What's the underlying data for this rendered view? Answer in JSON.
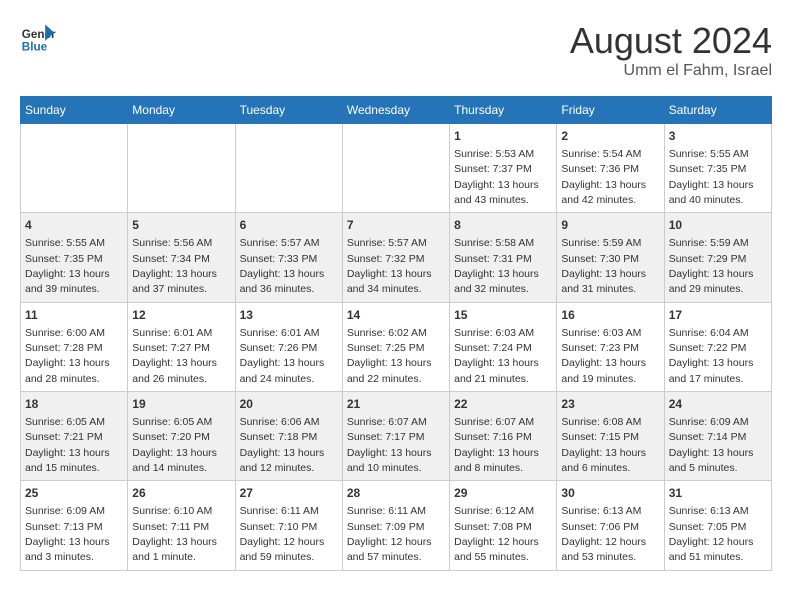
{
  "header": {
    "logo_line1": "General",
    "logo_line2": "Blue",
    "title": "August 2024",
    "subtitle": "Umm el Fahm, Israel"
  },
  "weekdays": [
    "Sunday",
    "Monday",
    "Tuesday",
    "Wednesday",
    "Thursday",
    "Friday",
    "Saturday"
  ],
  "weeks": [
    [
      {
        "day": "",
        "info": ""
      },
      {
        "day": "",
        "info": ""
      },
      {
        "day": "",
        "info": ""
      },
      {
        "day": "",
        "info": ""
      },
      {
        "day": "1",
        "info": "Sunrise: 5:53 AM\nSunset: 7:37 PM\nDaylight: 13 hours\nand 43 minutes."
      },
      {
        "day": "2",
        "info": "Sunrise: 5:54 AM\nSunset: 7:36 PM\nDaylight: 13 hours\nand 42 minutes."
      },
      {
        "day": "3",
        "info": "Sunrise: 5:55 AM\nSunset: 7:35 PM\nDaylight: 13 hours\nand 40 minutes."
      }
    ],
    [
      {
        "day": "4",
        "info": "Sunrise: 5:55 AM\nSunset: 7:35 PM\nDaylight: 13 hours\nand 39 minutes."
      },
      {
        "day": "5",
        "info": "Sunrise: 5:56 AM\nSunset: 7:34 PM\nDaylight: 13 hours\nand 37 minutes."
      },
      {
        "day": "6",
        "info": "Sunrise: 5:57 AM\nSunset: 7:33 PM\nDaylight: 13 hours\nand 36 minutes."
      },
      {
        "day": "7",
        "info": "Sunrise: 5:57 AM\nSunset: 7:32 PM\nDaylight: 13 hours\nand 34 minutes."
      },
      {
        "day": "8",
        "info": "Sunrise: 5:58 AM\nSunset: 7:31 PM\nDaylight: 13 hours\nand 32 minutes."
      },
      {
        "day": "9",
        "info": "Sunrise: 5:59 AM\nSunset: 7:30 PM\nDaylight: 13 hours\nand 31 minutes."
      },
      {
        "day": "10",
        "info": "Sunrise: 5:59 AM\nSunset: 7:29 PM\nDaylight: 13 hours\nand 29 minutes."
      }
    ],
    [
      {
        "day": "11",
        "info": "Sunrise: 6:00 AM\nSunset: 7:28 PM\nDaylight: 13 hours\nand 28 minutes."
      },
      {
        "day": "12",
        "info": "Sunrise: 6:01 AM\nSunset: 7:27 PM\nDaylight: 13 hours\nand 26 minutes."
      },
      {
        "day": "13",
        "info": "Sunrise: 6:01 AM\nSunset: 7:26 PM\nDaylight: 13 hours\nand 24 minutes."
      },
      {
        "day": "14",
        "info": "Sunrise: 6:02 AM\nSunset: 7:25 PM\nDaylight: 13 hours\nand 22 minutes."
      },
      {
        "day": "15",
        "info": "Sunrise: 6:03 AM\nSunset: 7:24 PM\nDaylight: 13 hours\nand 21 minutes."
      },
      {
        "day": "16",
        "info": "Sunrise: 6:03 AM\nSunset: 7:23 PM\nDaylight: 13 hours\nand 19 minutes."
      },
      {
        "day": "17",
        "info": "Sunrise: 6:04 AM\nSunset: 7:22 PM\nDaylight: 13 hours\nand 17 minutes."
      }
    ],
    [
      {
        "day": "18",
        "info": "Sunrise: 6:05 AM\nSunset: 7:21 PM\nDaylight: 13 hours\nand 15 minutes."
      },
      {
        "day": "19",
        "info": "Sunrise: 6:05 AM\nSunset: 7:20 PM\nDaylight: 13 hours\nand 14 minutes."
      },
      {
        "day": "20",
        "info": "Sunrise: 6:06 AM\nSunset: 7:18 PM\nDaylight: 13 hours\nand 12 minutes."
      },
      {
        "day": "21",
        "info": "Sunrise: 6:07 AM\nSunset: 7:17 PM\nDaylight: 13 hours\nand 10 minutes."
      },
      {
        "day": "22",
        "info": "Sunrise: 6:07 AM\nSunset: 7:16 PM\nDaylight: 13 hours\nand 8 minutes."
      },
      {
        "day": "23",
        "info": "Sunrise: 6:08 AM\nSunset: 7:15 PM\nDaylight: 13 hours\nand 6 minutes."
      },
      {
        "day": "24",
        "info": "Sunrise: 6:09 AM\nSunset: 7:14 PM\nDaylight: 13 hours\nand 5 minutes."
      }
    ],
    [
      {
        "day": "25",
        "info": "Sunrise: 6:09 AM\nSunset: 7:13 PM\nDaylight: 13 hours\nand 3 minutes."
      },
      {
        "day": "26",
        "info": "Sunrise: 6:10 AM\nSunset: 7:11 PM\nDaylight: 13 hours\nand 1 minute."
      },
      {
        "day": "27",
        "info": "Sunrise: 6:11 AM\nSunset: 7:10 PM\nDaylight: 12 hours\nand 59 minutes."
      },
      {
        "day": "28",
        "info": "Sunrise: 6:11 AM\nSunset: 7:09 PM\nDaylight: 12 hours\nand 57 minutes."
      },
      {
        "day": "29",
        "info": "Sunrise: 6:12 AM\nSunset: 7:08 PM\nDaylight: 12 hours\nand 55 minutes."
      },
      {
        "day": "30",
        "info": "Sunrise: 6:13 AM\nSunset: 7:06 PM\nDaylight: 12 hours\nand 53 minutes."
      },
      {
        "day": "31",
        "info": "Sunrise: 6:13 AM\nSunset: 7:05 PM\nDaylight: 12 hours\nand 51 minutes."
      }
    ]
  ]
}
